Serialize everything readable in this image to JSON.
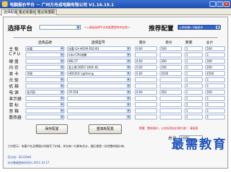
{
  "window": {
    "title": "电脑报价平台 － 广州方舟成电脑有限公司 V1.16.19.1",
    "controls": [
      "_",
      "□",
      "×"
    ]
  },
  "tabs": [
    "选择配置",
    "笔记本报价",
    "笔记本搭配"
  ],
  "platform": {
    "label": "选择平台",
    "value": ""
  },
  "hint": "<=请选选择平台和配置提供的信息>",
  "config": {
    "label": "推荐配置",
    "value": "上地电脑—2级组合"
  },
  "columns": [
    "选择品牌",
    "选择型号",
    "报价",
    "单价",
    "数量",
    "合计"
  ],
  "rows": [
    {
      "label": "主 板",
      "brand": "技嘉",
      "model": "技嘉 GA-H61M-DS2-B3",
      "price": "0.00",
      "unit": "500",
      "qty": "1",
      "total": "500"
    },
    {
      "label": "C P U",
      "brand": "",
      "model": "intel CPU奔腾",
      "price": "",
      "unit": "",
      "qty": "1",
      "total": "1"
    },
    {
      "label": "硬 盘",
      "brand": "",
      "model": "WD 1T",
      "price": "0.00",
      "unit": "300",
      "qty": "1",
      "total": "300"
    },
    {
      "label": "内 存",
      "brand": "",
      "model": "金士顿 DDR3 1600 4G",
      "price": "0.00",
      "unit": "200",
      "qty": "1",
      "total": "200"
    },
    {
      "label": "显 卡",
      "brand": "华硕",
      "model": "HD5450 Lightning",
      "price": "0.00",
      "unit": "4500",
      "qty": "1",
      "total": "4500"
    },
    {
      "label": "光 驱",
      "brand": "",
      "model": "",
      "price": "",
      "unit": "",
      "qty": "1",
      "total": "1"
    },
    {
      "label": "机 箱",
      "brand": "",
      "model": "",
      "price": "",
      "unit": "",
      "qty": "1",
      "total": "1"
    },
    {
      "label": "电 源",
      "brand": "金河田",
      "model": "CP-550",
      "price": "0.00",
      "unit": "350",
      "qty": "1",
      "total": "350"
    },
    {
      "label": "显示器",
      "brand": "",
      "model": "",
      "price": "",
      "unit": "",
      "qty": "1",
      "total": "1"
    },
    {
      "label": "鼠 标",
      "brand": "",
      "model": "",
      "price": "",
      "unit": "",
      "qty": "1",
      "total": "1"
    },
    {
      "label": "音 箱",
      "brand": "",
      "model": "",
      "price": "",
      "unit": "",
      "qty": "1",
      "total": "1"
    },
    {
      "label": "散热器",
      "brand": "",
      "model": "",
      "price": "",
      "unit": "",
      "qty": "1",
      "total": "1"
    }
  ],
  "buttons": {
    "save": "保存配置",
    "clear": "重填新配置"
  },
  "warning": "提醒：整体报价，以实际到店价格为准！ 请留意",
  "total": {
    "label": "总计",
    "value": "14880"
  },
  "info": {
    "line1": "工作提示：有客户在品牌报价时填写了价格，并在每一行都有合计，最后就是一份完整的报价单。",
    "line2": "官方站：B115946",
    "line3": "本次数据更新时间为 2011.10.17"
  },
  "watermark": "最需教育",
  "colors": {
    "titlebar": "#2a5bc0",
    "hint": "#e0141e",
    "selected": "#3366cc"
  }
}
